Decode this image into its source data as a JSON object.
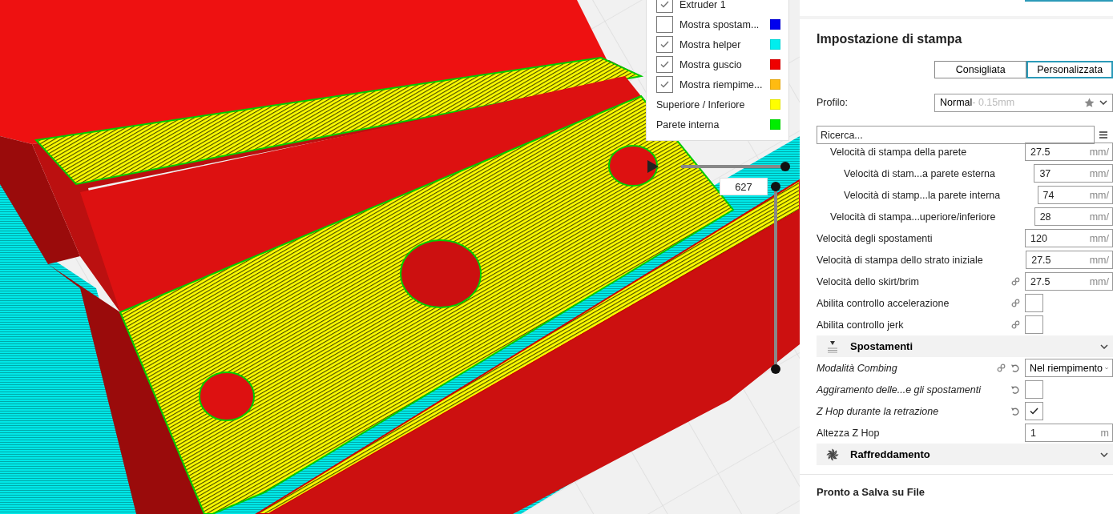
{
  "legend": {
    "items": [
      {
        "kind": "check",
        "label": "Extruder 1",
        "checked": true
      },
      {
        "kind": "check",
        "label": "Mostra spostam...",
        "checked": false,
        "color": "#0000ee"
      },
      {
        "kind": "check",
        "label": "Mostra helper",
        "checked": true,
        "color": "#00eeee"
      },
      {
        "kind": "check",
        "label": "Mostra guscio",
        "checked": true,
        "color": "#ee0000"
      },
      {
        "kind": "check",
        "label": "Mostra riempime...",
        "checked": true,
        "color": "#ffbb11"
      },
      {
        "kind": "plain",
        "label": "Superiore / Inferiore",
        "color": "#ffff00"
      },
      {
        "kind": "plain",
        "label": "Parete interna",
        "color": "#00ee00"
      }
    ]
  },
  "layer_slider": {
    "value": "627"
  },
  "panel": {
    "title": "Impostazione di stampa",
    "modes": [
      {
        "label": "Consigliata",
        "selected": false
      },
      {
        "label": "Personalizzata",
        "selected": true
      }
    ],
    "profile": {
      "label": "Profilo:",
      "name": "Normal",
      "detail": " - 0.15mm"
    },
    "search": {
      "placeholder": "Ricerca..."
    },
    "settings": [
      {
        "kind": "group",
        "children": [
          {
            "kind": "number",
            "label": "Velocità di stampa della parete",
            "value": "27.5",
            "unit": "mm/",
            "children": [
              {
                "kind": "number",
                "label": "Velocità di stam...a parete esterna",
                "value": "37",
                "unit": "mm/"
              },
              {
                "kind": "number",
                "label": "Velocità di stamp...la parete interna",
                "value": "74",
                "unit": "mm/"
              }
            ]
          },
          {
            "kind": "number",
            "label": "Velocità di stampa...uperiore/inferiore",
            "value": "28",
            "unit": "mm/"
          }
        ]
      },
      {
        "kind": "number",
        "label": "Velocità degli spostamenti",
        "value": "120",
        "unit": "mm/"
      },
      {
        "kind": "number",
        "label": "Velocità di stampa dello strato iniziale",
        "value": "27.5",
        "unit": "mm/"
      },
      {
        "kind": "number",
        "label": "Velocità dello skirt/brim",
        "value": "27.5",
        "unit": "mm/",
        "linked": true
      },
      {
        "kind": "checkbox",
        "label": "Abilita controllo accelerazione",
        "checked": false,
        "linked": true
      },
      {
        "kind": "checkbox",
        "label": "Abilita controllo jerk",
        "checked": false,
        "linked": true
      },
      {
        "kind": "section",
        "title": "Spostamenti"
      },
      {
        "kind": "select",
        "label": "Modalità Combing",
        "value": "Nel riempimento",
        "linked": true,
        "modified": true,
        "resettable": true
      },
      {
        "kind": "checkbox",
        "label": "Aggiramento delle...e gli spostamenti",
        "checked": false,
        "modified": true,
        "resettable": true
      },
      {
        "kind": "checkbox",
        "label": "Z Hop durante la retrazione",
        "checked": true,
        "modified": true,
        "resettable": true
      },
      {
        "kind": "number",
        "label": "Altezza Z Hop",
        "value": "1",
        "unit": "m"
      },
      {
        "kind": "section",
        "title": "Raffreddamento"
      }
    ]
  },
  "status": {
    "text": "Pronto a Salva su File"
  }
}
